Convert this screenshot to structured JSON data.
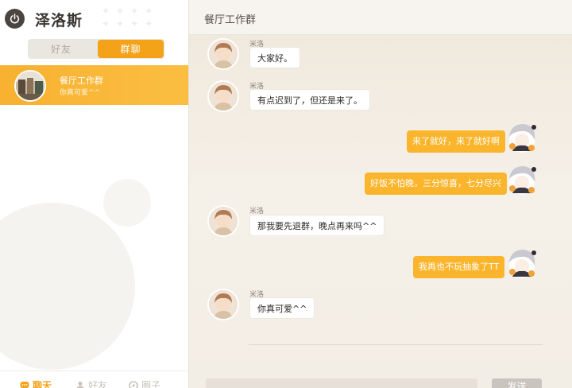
{
  "user": {
    "name": "泽洛斯"
  },
  "tabs": {
    "friends": "好友",
    "groups": "群聊"
  },
  "conversation": {
    "name": "餐厅工作群",
    "last_message": "你真可爱^^"
  },
  "bottom_nav": {
    "chat": "聊天",
    "friends": "好友",
    "circle": "圈子"
  },
  "chat": {
    "title": "餐厅工作群",
    "messages": [
      {
        "side": "left",
        "sender": "米洛",
        "text": "大家好。"
      },
      {
        "side": "left",
        "sender": "米洛",
        "text": "有点迟到了，但还是来了。"
      },
      {
        "side": "right",
        "text": "来了就好，来了就好啊"
      },
      {
        "side": "right",
        "text": "好饭不怕晚，三分惊喜，七分尽兴"
      },
      {
        "side": "left",
        "sender": "米洛",
        "text": "那我要先退群，晚点再来吗^^"
      },
      {
        "side": "right",
        "text": "我再也不玩抽象了TT"
      },
      {
        "side": "left",
        "sender": "米洛",
        "text": "你真可爱^^"
      }
    ],
    "send_label": "发送"
  },
  "colors": {
    "accent": "#f3a21a",
    "bubble_right": "#fab52d",
    "bubble_left": "#ffffff"
  },
  "icons": {
    "power": "power-icon",
    "chat": "chat-bubble-icon",
    "friends": "person-icon",
    "circle": "compass-icon"
  }
}
